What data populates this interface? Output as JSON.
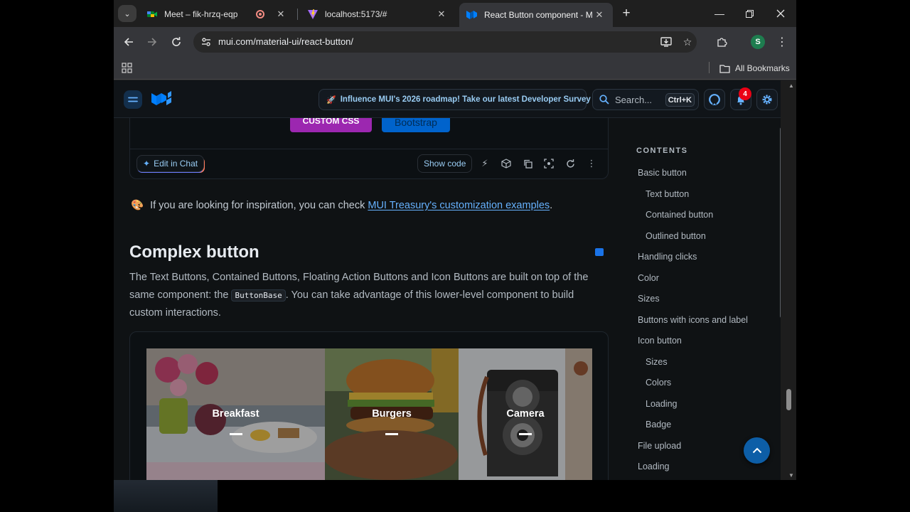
{
  "browser": {
    "tabs": [
      {
        "label": "Meet – fik-hrzq-eqp",
        "icon": "meet-icon"
      },
      {
        "label": "localhost:5173/#",
        "icon": "vite-icon"
      },
      {
        "label": "React Button component - Mate",
        "icon": "mui-icon",
        "active": true
      }
    ],
    "close_glyph": "✕",
    "new_tab_glyph": "+",
    "url": "mui.com/material-ui/react-button/",
    "avatar_letter": "S",
    "bookmarks_label": "All Bookmarks"
  },
  "header": {
    "promo": "Influence MUI's 2026 roadmap! Take our latest Developer Survey",
    "search_label": "Search...",
    "search_shortcut": "Ctrl+K",
    "notification_count": "4"
  },
  "demo_top": {
    "btn_custom_css": "CUSTOM CSS",
    "btn_bootstrap": "Bootstrap",
    "edit_chat": "Edit in Chat",
    "show_code": "Show code"
  },
  "content": {
    "inspiration_prefix": "If you are looking for inspiration, you can check",
    "inspiration_link": "MUI Treasury's customization examples",
    "inspiration_suffix": ".",
    "heading": "Complex button",
    "para_part1": "The Text Buttons, Contained Buttons, Floating Action Buttons and Icon Buttons are built on top of the same component: the",
    "para_code": "ButtonBase",
    "para_part2": ". You can take advantage of this lower-level component to build custom interactions."
  },
  "tiles": [
    {
      "title": "Breakfast"
    },
    {
      "title": "Burgers"
    },
    {
      "title": "Camera"
    }
  ],
  "toc": {
    "title": "CONTENTS",
    "items": [
      {
        "label": "Basic button",
        "level": 0
      },
      {
        "label": "Text button",
        "level": 1
      },
      {
        "label": "Contained button",
        "level": 1
      },
      {
        "label": "Outlined button",
        "level": 1
      },
      {
        "label": "Handling clicks",
        "level": 0
      },
      {
        "label": "Color",
        "level": 0
      },
      {
        "label": "Sizes",
        "level": 0
      },
      {
        "label": "Buttons with icons and label",
        "level": 0
      },
      {
        "label": "Icon button",
        "level": 0
      },
      {
        "label": "Sizes",
        "level": 1
      },
      {
        "label": "Colors",
        "level": 1
      },
      {
        "label": "Loading",
        "level": 1
      },
      {
        "label": "Badge",
        "level": 1
      },
      {
        "label": "File upload",
        "level": 0
      },
      {
        "label": "Loading",
        "level": 0
      }
    ]
  },
  "colors": {
    "primary_link": "#66b2ff",
    "custom_css_purple": "#9c27b0",
    "bootstrap_blue": "#0063cc",
    "badge_red": "#eb0014"
  }
}
